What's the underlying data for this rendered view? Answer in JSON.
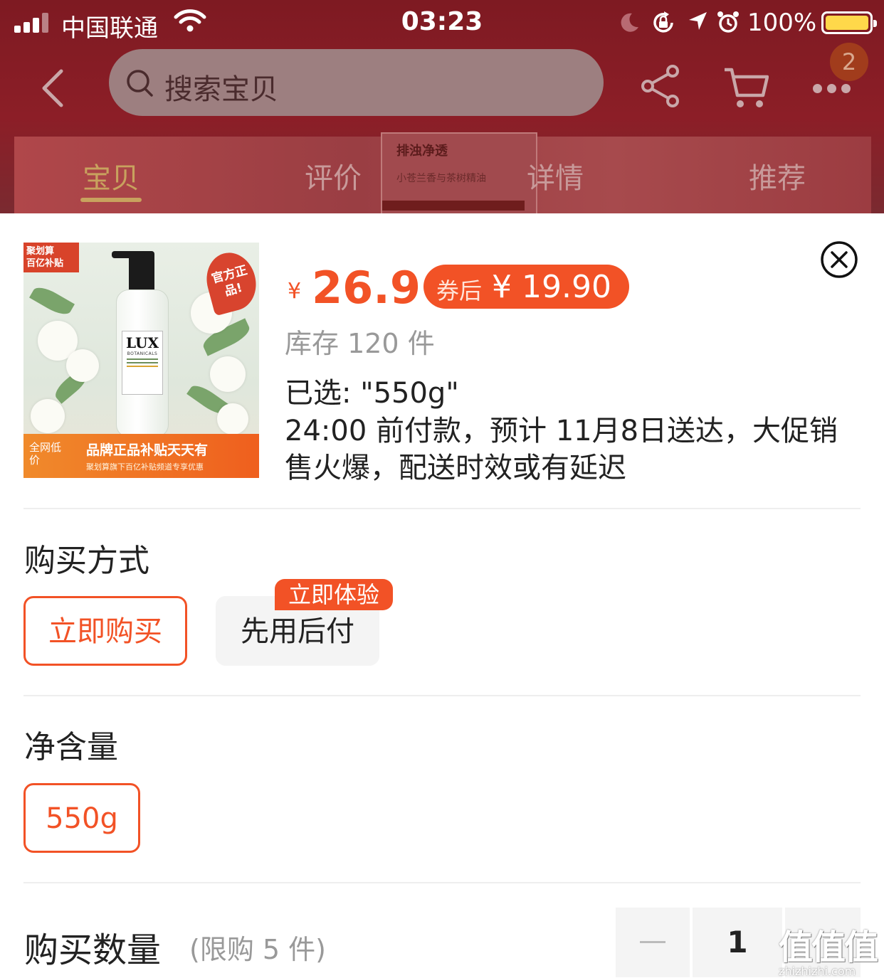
{
  "status_bar": {
    "carrier": "中国联通",
    "time": "03:23",
    "battery": "100%"
  },
  "nav": {
    "search_placeholder": "搜索宝贝",
    "cart_badge": "2"
  },
  "tabs": [
    {
      "label": "宝贝",
      "active": true
    },
    {
      "label": "评价",
      "active": false
    },
    {
      "label": "详情",
      "active": false
    },
    {
      "label": "推荐",
      "active": false
    }
  ],
  "background_card": {
    "title": "排浊净透",
    "subtitle": "小苍兰香与茶树精油"
  },
  "product": {
    "thumbnail": {
      "corner_tag": "聚划算\n百亿补贴",
      "official_badge": "官方正品!",
      "bottle_brand": "LUX",
      "bottle_sub": "BOTANICALS",
      "banner_lowest": "全网低价",
      "banner_main": "品牌正品补贴天天有",
      "banner_sub": "聚划算旗下百亿补贴频道专享优惠"
    },
    "currency": "¥",
    "price": "26.9",
    "coupon_label": "券后",
    "coupon_price": "¥ 19.90",
    "stock": "库存 120 件",
    "selected": "已选: \"550g\"",
    "delivery": "24:00 前付款，预计 11月8日送达，大促销售火爆，配送时效或有延迟"
  },
  "purchase_method": {
    "title": "购买方式",
    "options": [
      {
        "label": "立即购买",
        "selected": true
      },
      {
        "label": "先用后付",
        "selected": false
      }
    ],
    "promo_tag": "立即体验"
  },
  "net_content": {
    "title": "净含量",
    "options": [
      {
        "label": "550g",
        "selected": true
      }
    ]
  },
  "quantity": {
    "title": "购买数量",
    "limit": "(限购 5 件)",
    "value": "1"
  },
  "watermark": {
    "mark": "值值值",
    "url": "zhizhizhi.com"
  },
  "colors": {
    "accent": "#f25226",
    "nav_bg": "#8c1e27",
    "tab_active": "#c8a25e"
  }
}
